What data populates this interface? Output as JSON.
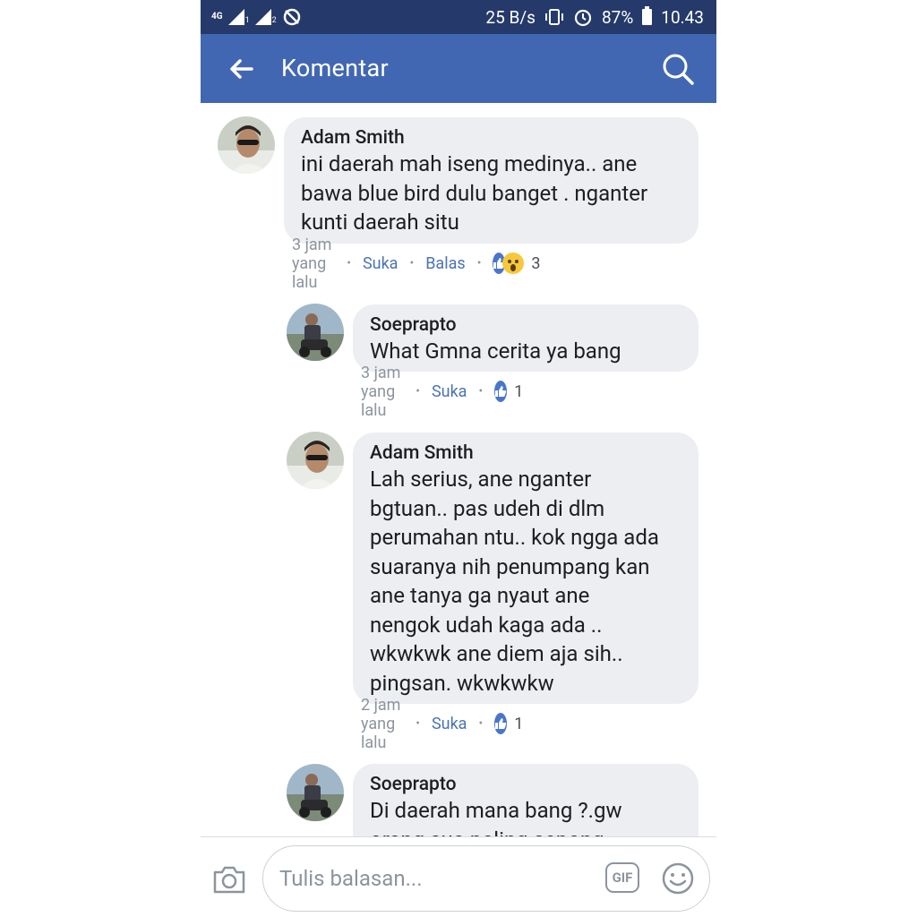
{
  "status_bar": {
    "network": "4G",
    "sim1": "1",
    "sim2": "2",
    "speed": "25 B/s",
    "battery": "87%",
    "time": "10.43"
  },
  "header": {
    "title": "Komentar"
  },
  "comments": [
    {
      "author": "Adam Smith",
      "text": "ini daerah mah iseng medinya.. ane\nbawa blue bird dulu banget . nganter\nkunti daerah situ",
      "time": "3 jam yang lalu",
      "like": "Suka",
      "reply": "Balas",
      "reactions": "3"
    },
    {
      "author": "Soeprapto",
      "text": "What Gmna cerita ya bang",
      "time": "3 jam yang lalu",
      "like": "Suka",
      "reactions": "1"
    },
    {
      "author": "Adam Smith",
      "text": "Lah serius, ane nganter\nbgtuan.. pas udeh di dlm\nperumahan ntu.. kok ngga ada\nsuaranya nih penumpang kan\nane tanya ga nyaut ane\nnengok udah kaga ada ..\nwkwkwk ane diem aja sih..\npingsan. wkwkwkw",
      "time": "2 jam yang lalu",
      "like": "Suka",
      "reactions": "1"
    },
    {
      "author": "Soeprapto",
      "text": "Di daerah mana bang  ?.gw\norang sua paling sepong"
    }
  ],
  "composer": {
    "placeholder": "Tulis balasan...",
    "gif_label": "GIF"
  },
  "colors": {
    "status_bar": "#25396b",
    "app_bar": "#4267b2",
    "bubble": "#eceef1",
    "link": "#4a73b4",
    "like": "#4a76c9"
  },
  "icons": [
    "back-arrow-icon",
    "search-icon",
    "like-icon",
    "wow-icon",
    "camera-icon",
    "gif-icon",
    "smiley-icon"
  ]
}
